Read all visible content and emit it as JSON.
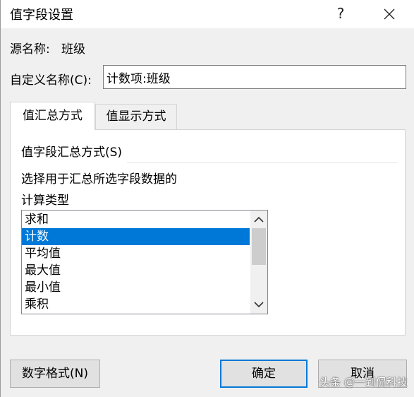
{
  "window": {
    "title": "值字段设置",
    "help_label": "?"
  },
  "source": {
    "label": "源名称:",
    "value": "班级"
  },
  "custom_name": {
    "label": "自定义名称(C):",
    "value": "计数项:班级"
  },
  "tabs": [
    {
      "label": "值汇总方式",
      "active": true
    },
    {
      "label": "值显示方式",
      "active": false
    }
  ],
  "summarize": {
    "group_title": "值字段汇总方式(S)",
    "description_line1": "选择用于汇总所选字段数据的",
    "description_line2": "计算类型",
    "items": [
      "求和",
      "计数",
      "平均值",
      "最大值",
      "最小值",
      "乘积"
    ],
    "selected": "计数"
  },
  "buttons": {
    "number_format": "数字格式(N)",
    "ok": "确定",
    "cancel": "取消"
  },
  "watermark": "头条 @一到侃科技",
  "colors": {
    "selection": "#0078d7",
    "default_button_border": "#0078d7"
  }
}
